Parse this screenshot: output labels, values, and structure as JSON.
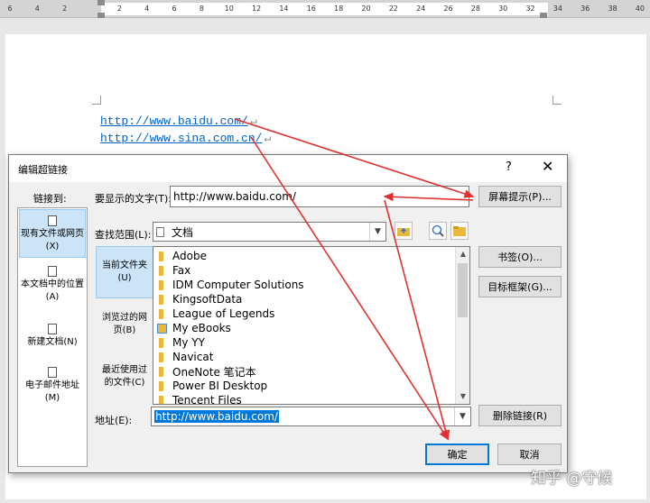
{
  "ruler": {
    "numbers": [
      "6",
      "4",
      "2",
      "",
      "2",
      "4",
      "6",
      "8",
      "10",
      "12",
      "14",
      "16",
      "18",
      "20",
      "22",
      "24",
      "26",
      "28",
      "30",
      "32",
      "34",
      "36",
      "38",
      "40"
    ]
  },
  "document": {
    "links": [
      "http://www.baidu.com/",
      "http://www.sina.com.cn/"
    ],
    "paragraph_mark": "↵"
  },
  "dialog": {
    "title": "编辑超链接",
    "help": "?",
    "close": "✕",
    "link_to_label": "链接到:",
    "link_to_items": [
      {
        "label": "现有文件或网页(X)",
        "selected": true
      },
      {
        "label": "本文档中的位置(A)",
        "selected": false
      },
      {
        "label": "新建文档(N)",
        "selected": false
      },
      {
        "label": "电子邮件地址(M)",
        "selected": false
      }
    ],
    "display_text_label": "要显示的文字(T):",
    "display_text_value": "http://www.baidu.com/",
    "screentip_button": "屏幕提示(P)...",
    "look_in_label": "查找范围(L):",
    "look_in_value": "文档",
    "side_buttons": [
      {
        "label": "当前文件夹(U)",
        "selected": true
      },
      {
        "label": "浏览过的网页(B)",
        "selected": false
      },
      {
        "label": "最近使用过的文件(C)",
        "selected": false
      }
    ],
    "files": [
      "Adobe",
      "Fax",
      "IDM Computer Solutions",
      "KingsoftData",
      "League of Legends",
      "My eBooks",
      "My YY",
      "Navicat",
      "OneNote 笔记本",
      "Power BI Desktop",
      "Tencent Files"
    ],
    "bookmark_button": "书签(O)...",
    "target_frame_button": "目标框架(G)...",
    "address_label": "地址(E):",
    "address_value": "http://www.baidu.com/",
    "remove_link_button": "删除链接(R)",
    "ok_button": "确定",
    "cancel_button": "取消"
  },
  "watermark": "知乎 @守候",
  "colors": {
    "accent": "#0078d7",
    "selection": "#cce4f7",
    "arrow": "#e03030",
    "link": "#0563c1"
  }
}
